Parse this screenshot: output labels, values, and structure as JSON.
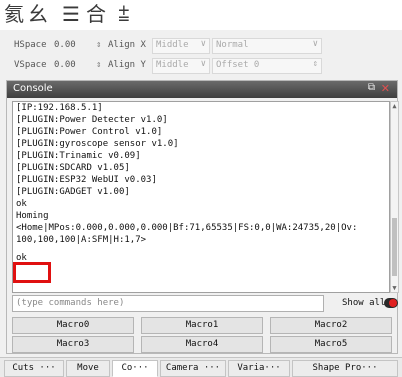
{
  "toolbar": {
    "icons": [
      "align-icon",
      "distribute-icon",
      "group-icon",
      "spacing-icon",
      "center-icon"
    ],
    "glyphs": [
      "氦",
      "幺",
      "☰",
      "合",
      "⩲"
    ]
  },
  "hspace": {
    "label": "HSpace",
    "value": "0.00",
    "align_label": "Align X",
    "align_value": "Middle",
    "mode": "Normal"
  },
  "vspace": {
    "label": "VSpace",
    "value": "0.00",
    "align_label": "Align Y",
    "align_value": "Middle",
    "offset": "Offset 0"
  },
  "console": {
    "title": "Console",
    "lines": [
      "[IP:192.168.5.1]",
      "[PLUGIN:Power Detecter v1.0]",
      "[PLUGIN:Power Control v1.0]",
      "[PLUGIN:gyroscope sensor v1.0]",
      "[PLUGIN:Trinamic v0.09]",
      "[PLUGIN:SDCARD v1.05]",
      "[PLUGIN:ESP32 WebUI v0.03]",
      "[PLUGIN:GADGET v1.00]",
      "ok",
      "Homing",
      "<Home|MPos:0.000,0.000,0.000|Bf:71,65535|FS:0,0|WA:24735,20|Ov:",
      "100,100,100|A:SFM|H:1,7>",
      "ok"
    ],
    "command_placeholder": "(type commands here)",
    "show_all_label": "Show all",
    "show_all_on": true
  },
  "macros": [
    "Macro0",
    "Macro1",
    "Macro2",
    "Macro3",
    "Macro4",
    "Macro5"
  ],
  "tabs": [
    "Cuts ···",
    "Move",
    "Co···",
    "Camera ···",
    "Varia···",
    "Shape Pro···"
  ],
  "active_tab": "Co···",
  "colors": {
    "highlight": "#e01010",
    "toggle_knob": "#e02020",
    "title_bar": "#4a4a4a"
  }
}
